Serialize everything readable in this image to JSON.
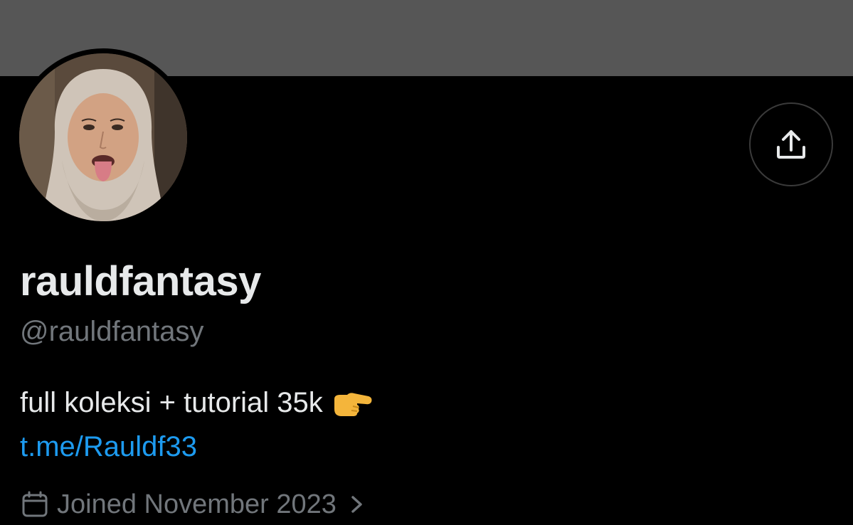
{
  "profile": {
    "display_name": "rauldfantasy",
    "handle": "@rauldfantasy",
    "bio_text": "full koleksi + tutorial 35k",
    "bio_emoji": "pointing-right-hand",
    "link_text": "t.me/Rauldf33",
    "joined_text": "Joined November 2023"
  },
  "icons": {
    "share": "share-upload-icon",
    "calendar": "calendar-icon",
    "chevron": "chevron-right-icon"
  },
  "colors": {
    "banner": "#565656",
    "background": "#000000",
    "primary_text": "#e7e9ea",
    "secondary_text": "#71767b",
    "link": "#1d9bf0"
  }
}
